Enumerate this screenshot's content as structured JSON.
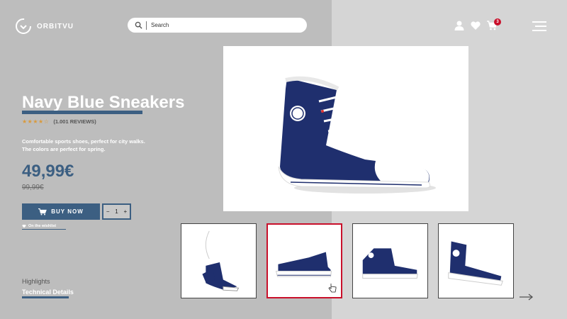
{
  "header": {
    "brand": "ORBITVU",
    "search_placeholder": "Search",
    "cart_count": "3"
  },
  "product": {
    "title": "Navy Blue Sneakers",
    "rating_stars": 4.5,
    "reviews": "(1.001 REVIEWS)",
    "description_line1": "Comfortable sports shoes, perfect for city walks.",
    "description_line2": "The colors are perfect for spring.",
    "price": "49,99€",
    "old_price": "99,99€",
    "buy_label": "BUY NOW",
    "quantity": "1",
    "qty_minus": "−",
    "qty_plus": "+",
    "wishlist_label": "On the wishlist"
  },
  "sections": {
    "highlights": "Highlights",
    "technical": "Technical Details"
  },
  "gallery": {
    "selected_index": 1,
    "thumbnails": [
      "shoe-hanging",
      "shoe-side",
      "shoe-front-angle",
      "shoe-back-angle"
    ]
  },
  "colors": {
    "accent": "#3c5f82",
    "badge": "#c9102b",
    "stars": "#d99a3c",
    "shoe": "#1f2f6e"
  }
}
